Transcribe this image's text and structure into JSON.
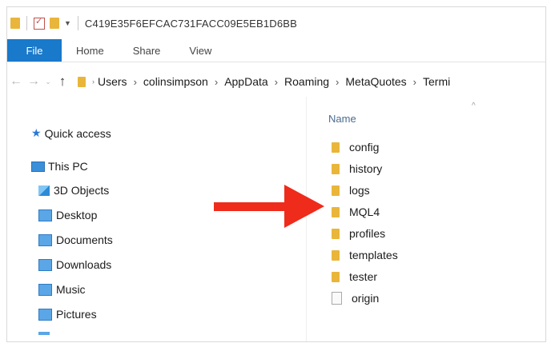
{
  "window": {
    "title": "C419E35F6EFCAC731FACC09E5EB1D6BB"
  },
  "ribbon": {
    "tabs": [
      "File",
      "Home",
      "Share",
      "View"
    ]
  },
  "address": {
    "crumbs": [
      "Users",
      "colinsimpson",
      "AppData",
      "Roaming",
      "MetaQuotes",
      "Termi"
    ]
  },
  "navpane": {
    "quick_access": "Quick access",
    "this_pc": "This PC",
    "items": [
      "3D Objects",
      "Desktop",
      "Documents",
      "Downloads",
      "Music",
      "Pictures"
    ]
  },
  "content": {
    "column_header": "Name",
    "folders": [
      "config",
      "history",
      "logs",
      "MQL4",
      "profiles",
      "templates",
      "tester"
    ],
    "files": [
      "origin"
    ]
  },
  "annotation": {
    "arrow_color": "#ef2b1c",
    "target": "MQL4"
  },
  "colors": {
    "accent": "#1979ca",
    "folder": "#e9b63b"
  }
}
